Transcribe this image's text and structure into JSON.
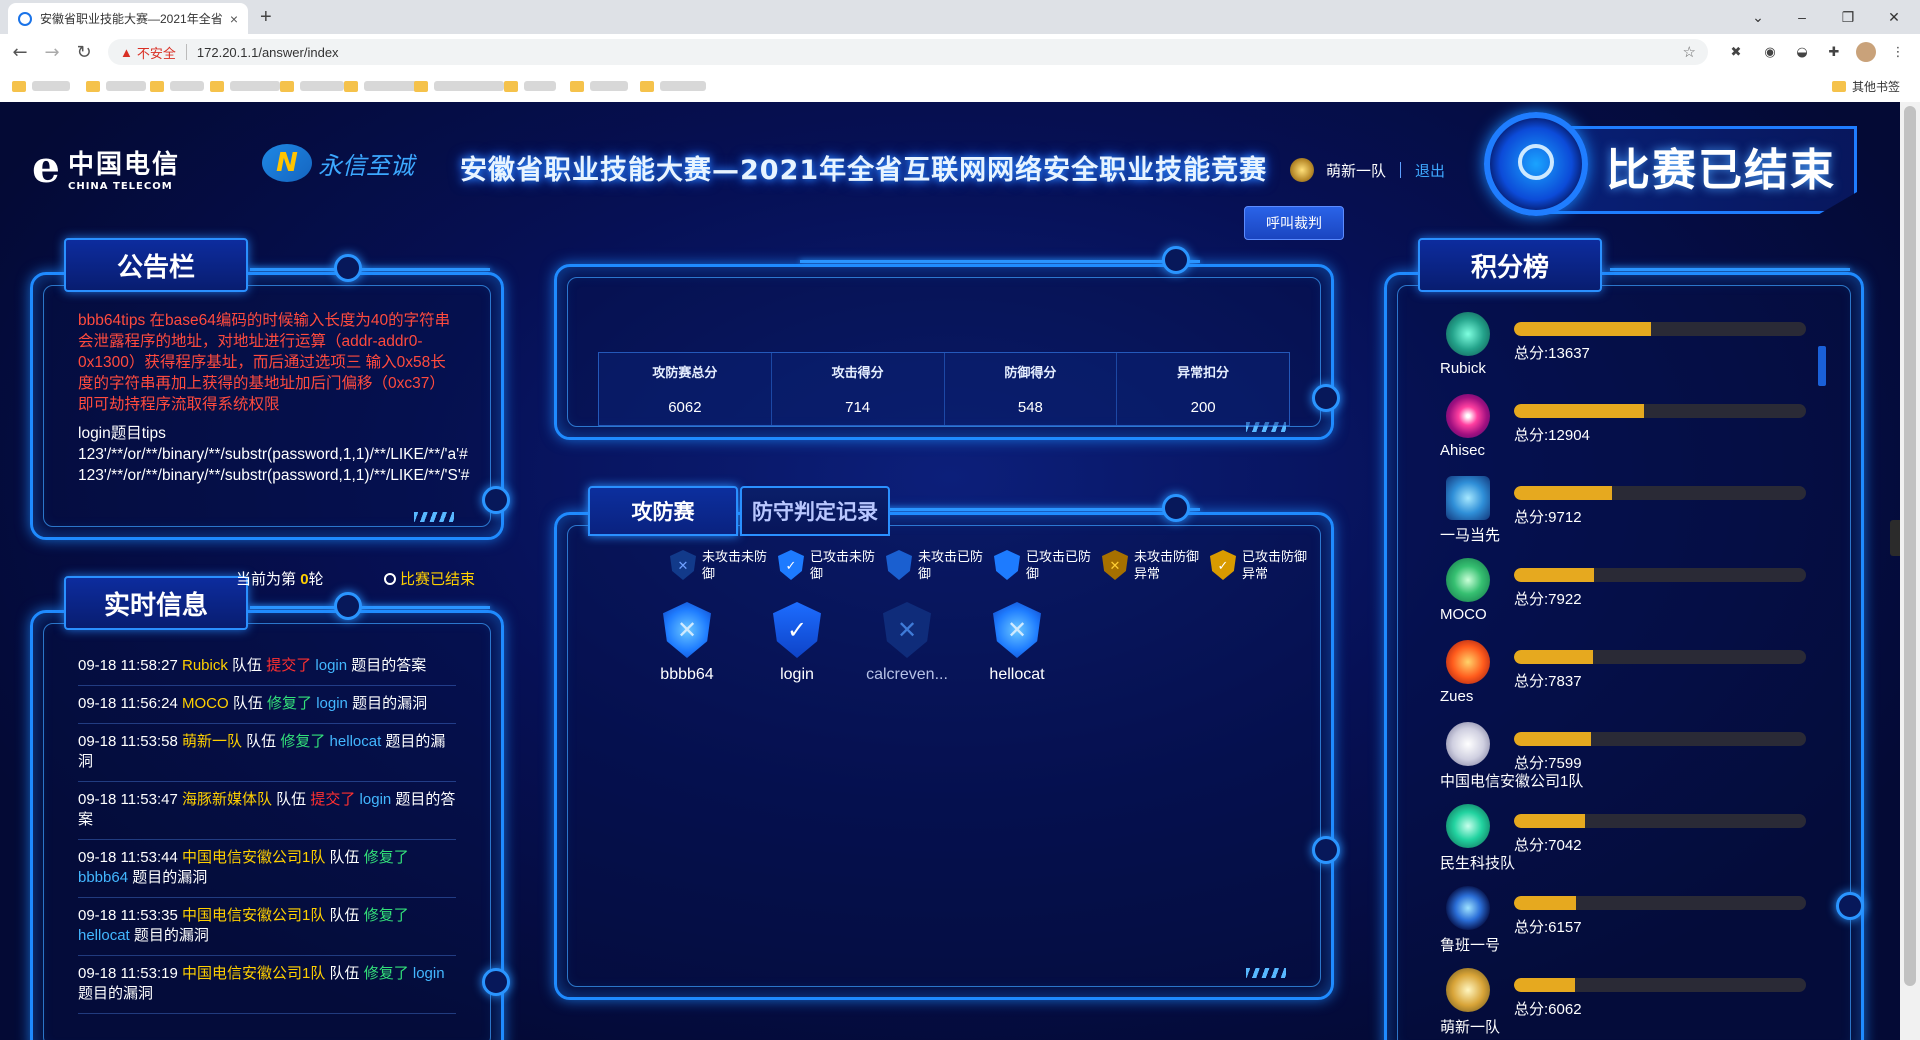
{
  "browser": {
    "tab_title": "安徽省职业技能大赛—2021年全省",
    "tab_close": "×",
    "new_tab": "+",
    "win_min": "–",
    "win_max": "❐",
    "win_close": "✕",
    "security_label": "不安全",
    "url": "172.20.1.1/answer/index",
    "other_bookmarks": "其他书签"
  },
  "header": {
    "ct_logo_mark": "e",
    "ct_logo_cn": "中国电信",
    "ct_logo_en": "CHINA TELECOM",
    "yx_logo_mark": "N",
    "yx_logo_text": "永信至诚",
    "title": "安徽省职业技能大赛—2021年全省互联网网络安全职业技能竞赛",
    "team_name": "萌新一队",
    "logout": "退出",
    "status": "比赛已结束",
    "call_referee": "呼叫裁判"
  },
  "notice": {
    "title": "公告栏",
    "red_text": "bbb64tips 在base64编码的时候输入长度为40的字符串会泄露程序的地址，对地址进行运算（addr-addr0-0x1300）获得程序基址，而后通过选项三 输入0x58长度的字符串再加上获得的基地址加后门偏移（0xc37）即可劫持程序流取得系统权限",
    "white_text": "login题目tips 123'/**/or/**/binary/**/substr(password,1,1)/**/LIKE/**/'a'# 123'/**/or/**/binary/**/substr(password,1,1)/**/LIKE/**/'S'#"
  },
  "realtime": {
    "title": "实时信息",
    "round_prefix": "当前为第",
    "round_num": "0",
    "round_suffix": "轮",
    "round_status": "比赛已结束",
    "items": [
      {
        "time": "09-18 11:58:27",
        "team": "Rubick",
        "team_word": "队伍",
        "action": "提交了",
        "action_type": "red",
        "challenge": "login",
        "tail": "题目的答案"
      },
      {
        "time": "09-18 11:56:24",
        "team": "MOCO",
        "team_word": "队伍",
        "action": "修复了",
        "action_type": "green",
        "challenge": "login",
        "tail": "题目的漏洞"
      },
      {
        "time": "09-18 11:53:58",
        "team": "萌新一队",
        "team_word": "队伍",
        "action": "修复了",
        "action_type": "green",
        "challenge": "hellocat",
        "tail": "题目的漏洞"
      },
      {
        "time": "09-18 11:53:47",
        "team": "海豚新媒体队",
        "team_word": "队伍",
        "action": "提交了",
        "action_type": "red",
        "challenge": "login",
        "tail": "题目的答案"
      },
      {
        "time": "09-18 11:53:44",
        "team": "中国电信安徽公司1队",
        "team_word": "队伍",
        "action": "修复了",
        "action_type": "green",
        "challenge": "bbbb64",
        "tail": "题目的漏洞"
      },
      {
        "time": "09-18 11:53:35",
        "team": "中国电信安徽公司1队",
        "team_word": "队伍",
        "action": "修复了",
        "action_type": "green",
        "challenge": "hellocat",
        "tail": "题目的漏洞"
      },
      {
        "time": "09-18 11:53:19",
        "team": "中国电信安徽公司1队",
        "team_word": "队伍",
        "action": "修复了",
        "action_type": "green",
        "challenge": "login",
        "tail": "题目的漏洞"
      }
    ]
  },
  "stats": {
    "headers": [
      "攻防赛总分",
      "攻击得分",
      "防御得分",
      "异常扣分"
    ],
    "values": [
      "6062",
      "714",
      "548",
      "200"
    ]
  },
  "tabs": [
    "攻防赛",
    "防守判定记录"
  ],
  "legend": [
    {
      "label": "未攻击未防御",
      "icon": "shield-dark-x-icon"
    },
    {
      "label": "已攻击未防御",
      "icon": "shield-check-icon"
    },
    {
      "label": "未攻击已防御",
      "icon": "shield-blue-icon"
    },
    {
      "label": "已攻击已防御",
      "icon": "shield-blue-glow-icon"
    },
    {
      "label": "未攻击防御异常",
      "icon": "shield-gold-x-icon"
    },
    {
      "label": "已攻击防御异常",
      "icon": "shield-gold-check-icon"
    }
  ],
  "challenges": [
    {
      "name": "bbbb64",
      "icon": "shield-glow-icon"
    },
    {
      "name": "login",
      "icon": "shield-check-icon"
    },
    {
      "name": "calcreven...",
      "icon": "shield-dark-x-icon"
    },
    {
      "name": "hellocat",
      "icon": "shield-glow-icon"
    }
  ],
  "scoreboard": {
    "title": "积分榜",
    "teams": [
      {
        "name": "Rubick",
        "total": "总分:13637",
        "score": 13637
      },
      {
        "name": "Ahisec",
        "total": "总分:12904",
        "score": 12904
      },
      {
        "name": "一马当先",
        "total": "总分:9712",
        "score": 9712
      },
      {
        "name": "MOCO",
        "total": "总分:7922",
        "score": 7922
      },
      {
        "name": "Zues",
        "total": "总分:7837",
        "score": 7837
      },
      {
        "name": "中国电信安徽公司1队",
        "total": "总分:7599",
        "score": 7599
      },
      {
        "name": "民生科技队",
        "total": "总分:7042",
        "score": 7042
      },
      {
        "name": "鲁班一号",
        "total": "总分:6157",
        "score": 6157
      },
      {
        "name": "萌新一队",
        "total": "总分:6062",
        "score": 6062
      }
    ]
  },
  "colors": {
    "accent": "#1f8bff",
    "gold": "#e6a91f",
    "team_yellow": "#ffd000",
    "action_red": "#ff3030",
    "action_green": "#33e07a"
  }
}
